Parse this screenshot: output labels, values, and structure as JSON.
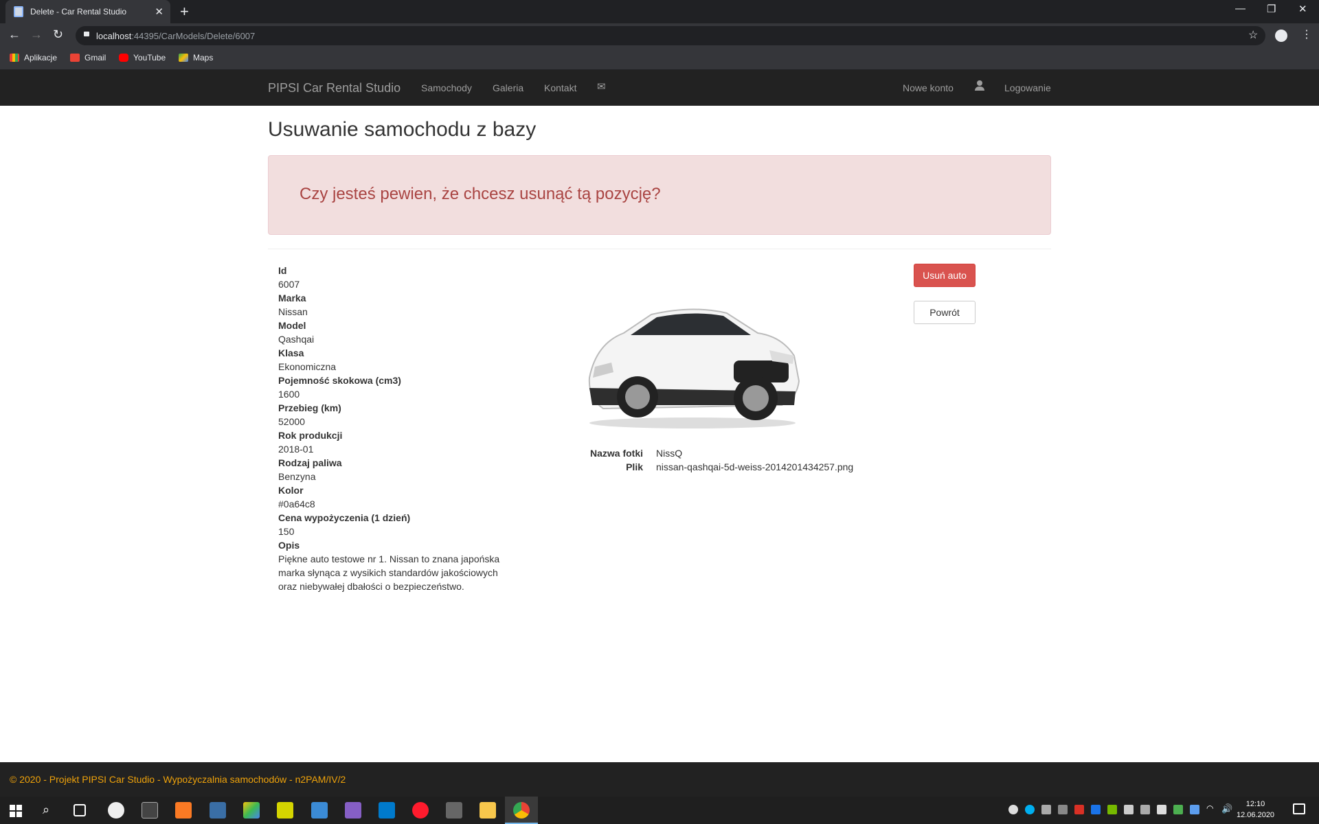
{
  "browser": {
    "tab_title": "Delete - Car Rental Studio",
    "url_host": "localhost",
    "url_rest": ":44395/CarModels/Delete/6007",
    "bookmarks": [
      "Aplikacje",
      "Gmail",
      "YouTube",
      "Maps"
    ]
  },
  "nav": {
    "brand": "PIPSI Car Rental Studio",
    "links": [
      "Samochody",
      "Galeria",
      "Kontakt"
    ],
    "register": "Nowe konto",
    "login": "Logowanie"
  },
  "page": {
    "title": "Usuwanie samochodu z bazy",
    "alert": "Czy jesteś pewien, że chcesz usunąć tą pozycję?",
    "fields": [
      {
        "label": "Id",
        "value": "6007"
      },
      {
        "label": "Marka",
        "value": "Nissan"
      },
      {
        "label": "Model",
        "value": "Qashqai"
      },
      {
        "label": "Klasa",
        "value": "Ekonomiczna"
      },
      {
        "label": "Pojemność skokowa (cm3)",
        "value": "1600"
      },
      {
        "label": "Przebieg (km)",
        "value": "52000"
      },
      {
        "label": "Rok produkcji",
        "value": "2018-01"
      },
      {
        "label": "Rodzaj paliwa",
        "value": "Benzyna"
      },
      {
        "label": "Kolor",
        "value": "#0a64c8"
      },
      {
        "label": "Cena wypożyczenia (1 dzień)",
        "value": "150"
      }
    ],
    "desc_label": "Opis",
    "desc": "Piękne auto testowe nr 1. Nissan to znana japońska marka słynąca z wysikich standardów jakościowych oraz niebywałej dbałości o bezpieczeństwo.",
    "photo": {
      "name_label": "Nazwa fotki",
      "name_value": "NissQ",
      "file_label": "Plik",
      "file_value": "nissan-qashqai-5d-weiss-2014201434257.png"
    },
    "delete_button": "Usuń auto",
    "back_button": "Powrót"
  },
  "footer": {
    "text": "© 2020 - Projekt PIPSI Car Studio - Wypożyczalnia samochodów - n2PAM/IV/2"
  },
  "taskbar": {
    "time": "12:10",
    "date": "12.06.2020"
  }
}
